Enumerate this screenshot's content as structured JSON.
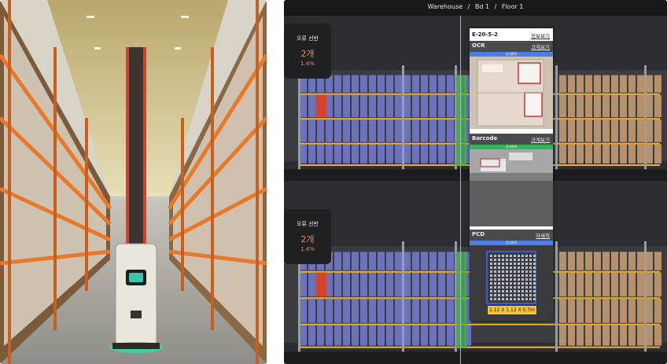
{
  "breadcrumb": {
    "warehouse": "Warehouse",
    "sep": "/",
    "building": "Bd 1",
    "floor": "Floor 1"
  },
  "error_cards": [
    {
      "title": "오류 선반",
      "count": "2개",
      "percent": "1.4%"
    },
    {
      "title": "오류 선반",
      "count": "2개",
      "percent": "1.4%"
    }
  ],
  "inspection": {
    "location_id": "E-20-5-2",
    "location_link": "정보보기",
    "sections": [
      {
        "name": "OCR",
        "link": "크게보기",
        "status": "검사완료",
        "status_color": "#4d7ee8"
      },
      {
        "name": "Barcode",
        "link": "크게보기",
        "status": "검사완료",
        "status_color": "#2fb35b"
      },
      {
        "name": "PCD",
        "link": "자세히",
        "status": "검사완료",
        "status_color": "#4d7ee8"
      }
    ],
    "dimension_label": "1.12 X 1.12 X 0.7m"
  },
  "colors": {
    "accent_line": "#8fd14f",
    "error_text": "#f08a4b",
    "rack_beam": "#f0b22a",
    "box_blue": "#6f78c9",
    "box_brown": "#c49a72"
  }
}
